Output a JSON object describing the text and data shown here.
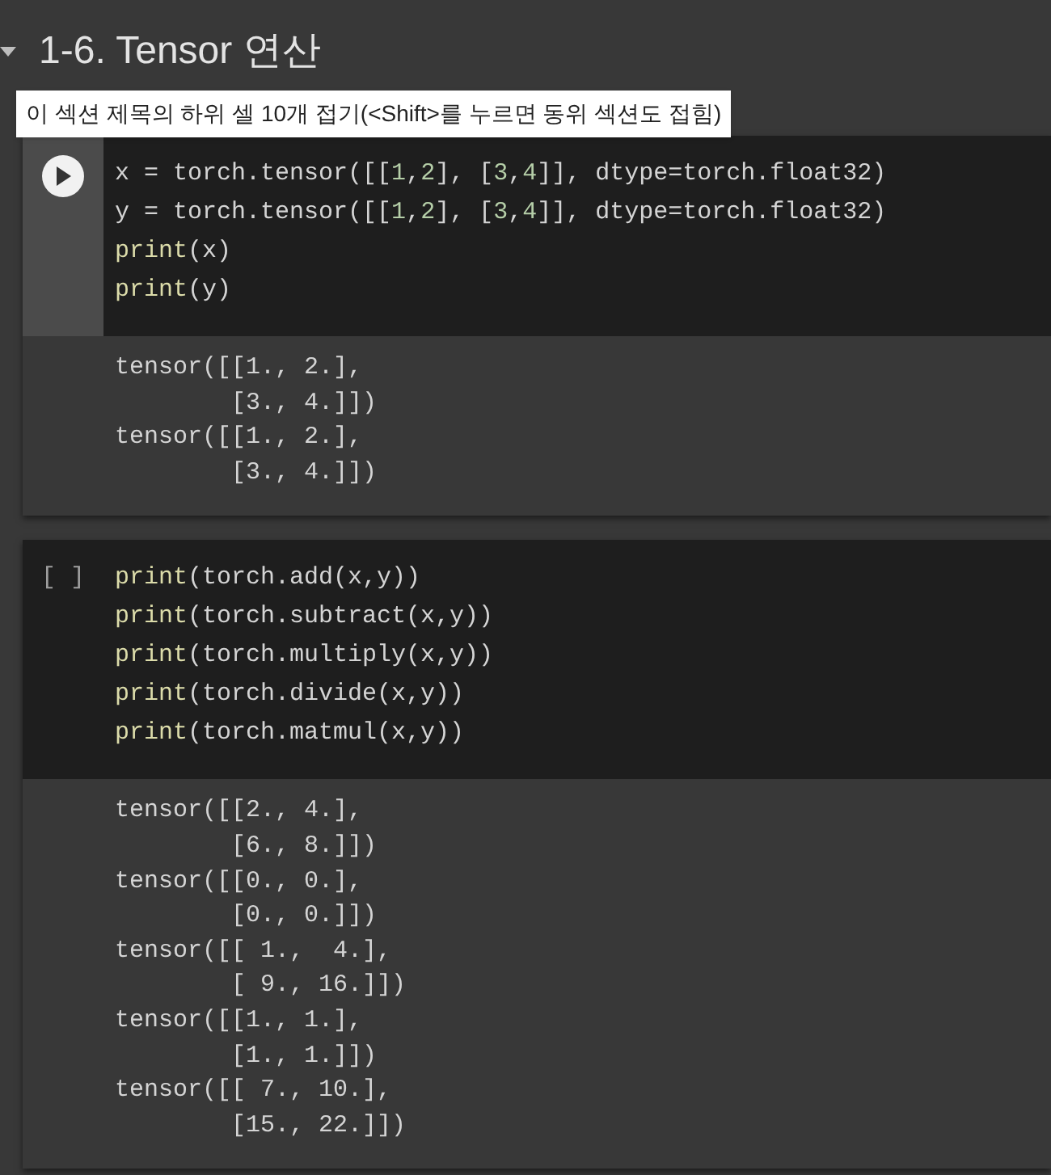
{
  "section": {
    "title": "1-6. Tensor 연산",
    "expanded": true
  },
  "tooltip": "이 섹션 제목의 하위 셀 10개 접기(<Shift>를 누르면 동위 섹션도 접힘)",
  "cells": [
    {
      "gutter": {
        "kind": "run-button"
      },
      "code": [
        [
          {
            "kind": "plain",
            "text": "x = torch.tensor([["
          },
          {
            "kind": "number",
            "text": "1"
          },
          {
            "kind": "plain",
            "text": ","
          },
          {
            "kind": "number",
            "text": "2"
          },
          {
            "kind": "plain",
            "text": "], ["
          },
          {
            "kind": "number",
            "text": "3"
          },
          {
            "kind": "plain",
            "text": ","
          },
          {
            "kind": "number",
            "text": "4"
          },
          {
            "kind": "plain",
            "text": "]], dtype=torch.float32)"
          }
        ],
        [
          {
            "kind": "plain",
            "text": "y = torch.tensor([["
          },
          {
            "kind": "number",
            "text": "1"
          },
          {
            "kind": "plain",
            "text": ","
          },
          {
            "kind": "number",
            "text": "2"
          },
          {
            "kind": "plain",
            "text": "], ["
          },
          {
            "kind": "number",
            "text": "3"
          },
          {
            "kind": "plain",
            "text": ","
          },
          {
            "kind": "number",
            "text": "4"
          },
          {
            "kind": "plain",
            "text": "]], dtype=torch.float32)"
          }
        ],
        [
          {
            "kind": "builtin",
            "text": "print"
          },
          {
            "kind": "plain",
            "text": "(x)"
          }
        ],
        [
          {
            "kind": "builtin",
            "text": "print"
          },
          {
            "kind": "plain",
            "text": "(y)"
          }
        ]
      ],
      "output": [
        "tensor([[1., 2.],",
        "        [3., 4.]])",
        "tensor([[1., 2.],",
        "        [3., 4.]])"
      ]
    },
    {
      "gutter": {
        "kind": "counter",
        "text": "[ ]"
      },
      "code": [
        [
          {
            "kind": "builtin",
            "text": "print"
          },
          {
            "kind": "plain",
            "text": "(torch.add(x,y))"
          }
        ],
        [
          {
            "kind": "builtin",
            "text": "print"
          },
          {
            "kind": "plain",
            "text": "(torch.subtract(x,y))"
          }
        ],
        [
          {
            "kind": "builtin",
            "text": "print"
          },
          {
            "kind": "plain",
            "text": "(torch.multiply(x,y))"
          }
        ],
        [
          {
            "kind": "builtin",
            "text": "print"
          },
          {
            "kind": "plain",
            "text": "(torch.divide(x,y))"
          }
        ],
        [
          {
            "kind": "builtin",
            "text": "print"
          },
          {
            "kind": "plain",
            "text": "(torch.matmul(x,y))"
          }
        ]
      ],
      "output": [
        "tensor([[2., 4.],",
        "        [6., 8.]])",
        "tensor([[0., 0.],",
        "        [0., 0.]])",
        "tensor([[ 1.,  4.],",
        "        [ 9., 16.]])",
        "tensor([[1., 1.],",
        "        [1., 1.]])",
        "tensor([[ 7., 10.],",
        "        [15., 22.]])"
      ]
    }
  ]
}
